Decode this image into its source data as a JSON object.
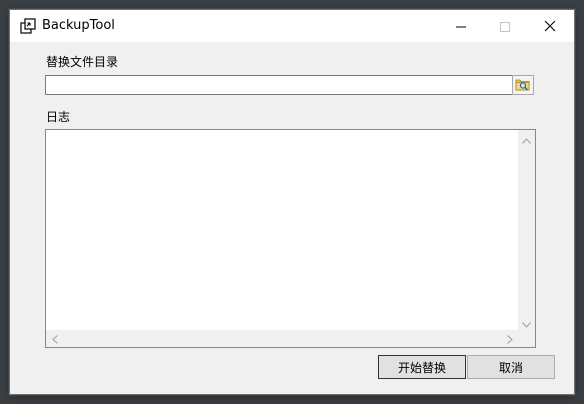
{
  "window": {
    "title": "BackupTool",
    "app_icon": "backup-app-icon"
  },
  "titlebar_buttons": {
    "minimize": "minimize-icon",
    "maximize": "maximize-icon",
    "close": "close-icon"
  },
  "form": {
    "dir_label": "替换文件目录",
    "dir_value": "",
    "dir_placeholder": "",
    "browse_icon": "folder-search-icon",
    "log_label": "日志",
    "log_text": ""
  },
  "buttons": {
    "start_label": "开始替换",
    "cancel_label": "取消"
  },
  "colors": {
    "window_bg": "#f0f0f0",
    "titlebar_bg": "#ffffff",
    "button_bg": "#e1e1e1",
    "input_border": "#7a7a7a"
  }
}
